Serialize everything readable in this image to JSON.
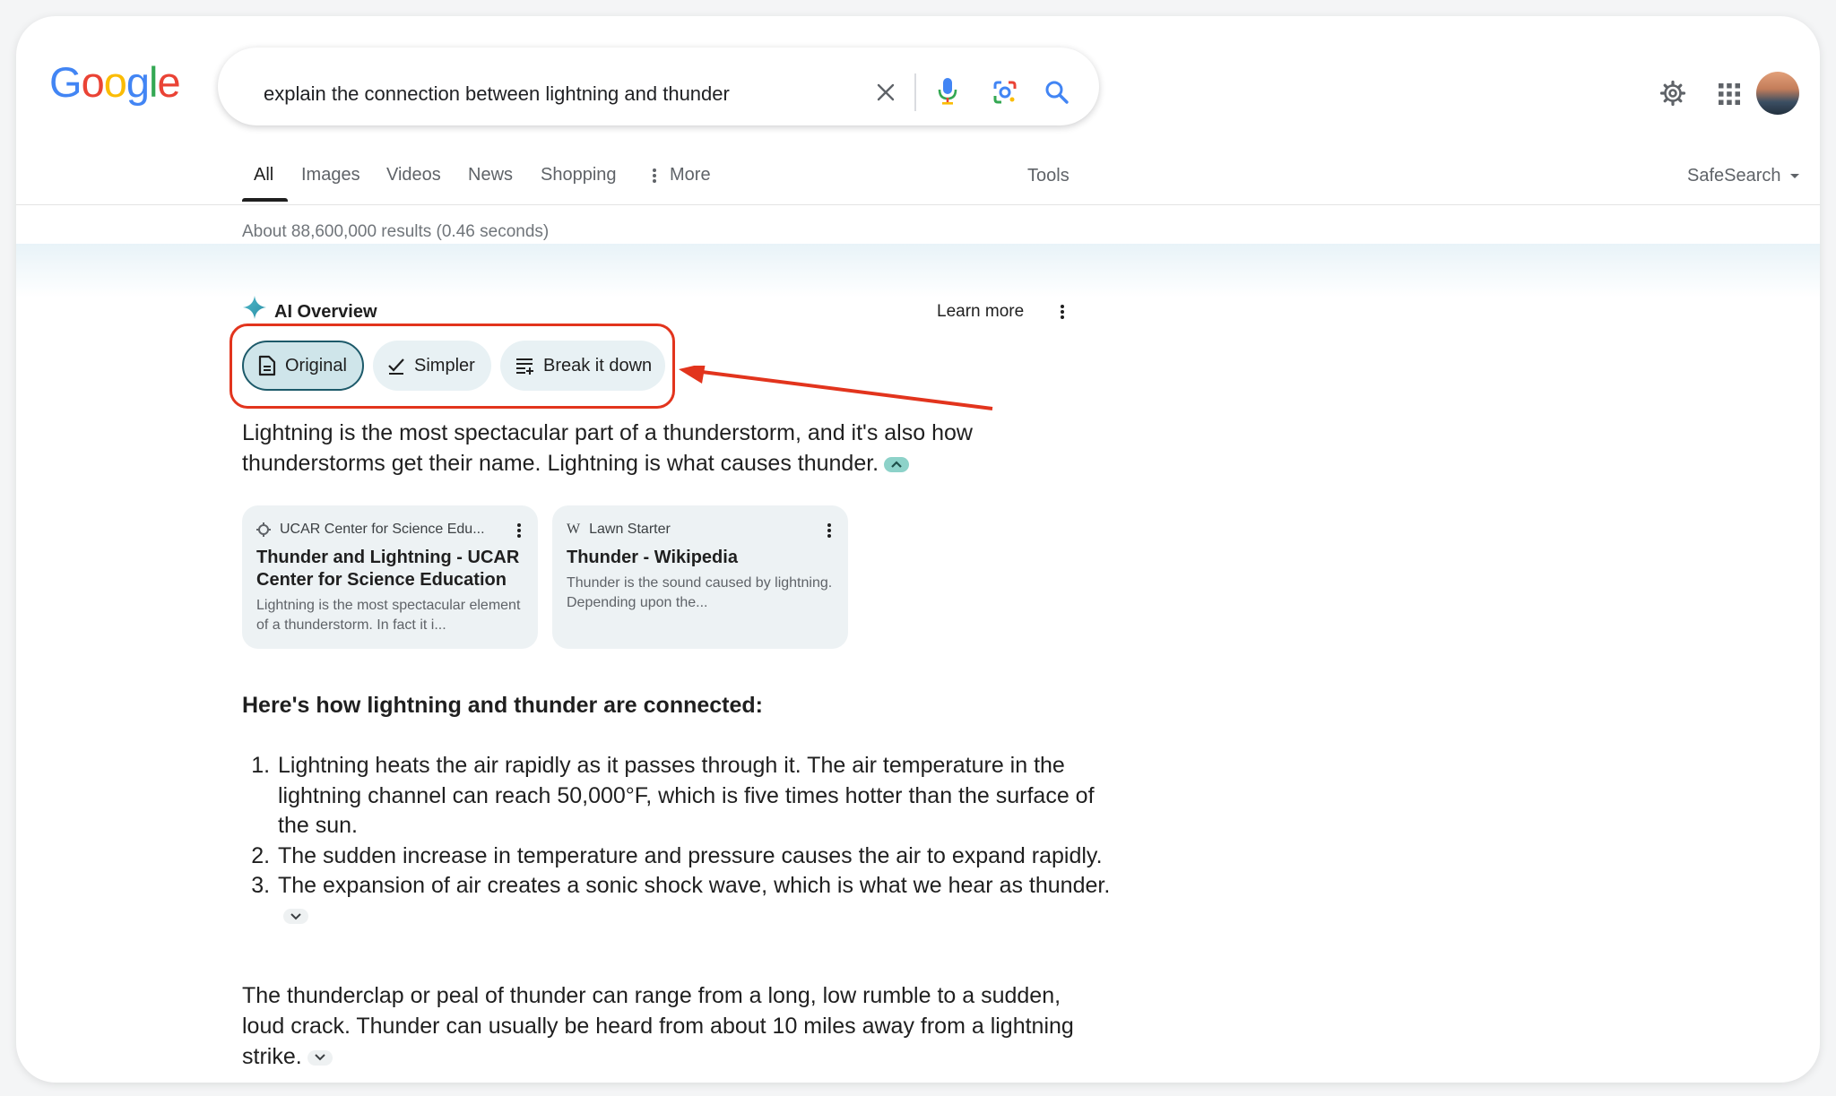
{
  "logo": {
    "letters": [
      "G",
      "o",
      "o",
      "g",
      "l",
      "e"
    ],
    "colors": [
      "#4285F4",
      "#EA4335",
      "#FBBC05",
      "#4285F4",
      "#34A853",
      "#EA4335"
    ]
  },
  "search": {
    "query": "explain the connection between lightning and thunder",
    "icons": [
      "close-icon",
      "mic-icon",
      "lens-icon",
      "search-icon"
    ]
  },
  "header_icons": [
    "settings-icon",
    "apps-icon",
    "avatar"
  ],
  "tabs": [
    "All",
    "Images",
    "Videos",
    "News",
    "Shopping",
    "More"
  ],
  "tools_label": "Tools",
  "safesearch_label": "SafeSearch",
  "stats": "About 88,600,000 results (0.46 seconds)",
  "ai_overview": {
    "title": "AI Overview",
    "learn_more": "Learn more",
    "modes": [
      {
        "label": "Original",
        "icon": "document-icon",
        "selected": true
      },
      {
        "label": "Simpler",
        "icon": "check-icon",
        "selected": false
      },
      {
        "label": "Break it down",
        "icon": "list-icon",
        "selected": false
      }
    ],
    "intro": "Lightning is the most spectacular part of a thunderstorm, and it's also how thunderstorms get their name. Lightning is what causes thunder.",
    "sources": [
      {
        "site": "UCAR Center for Science Edu...",
        "title": "Thunder and Lightning - UCAR Center for Science Education",
        "snippet": "Lightning is the most spectacular element of a thunderstorm. In fact it i..."
      },
      {
        "site": "Lawn Starter",
        "title": "Thunder - Wikipedia",
        "snippet": "Thunder is the sound caused by lightning. Depending upon the..."
      }
    ],
    "heading": "Here's how lightning and thunder are connected:",
    "steps": [
      "Lightning heats the air rapidly as it passes through it. The air temperature in the lightning channel can reach 50,000°F, which is five times hotter than the surface of the sun.",
      "The sudden increase in temperature and pressure causes the air to expand rapidly.",
      "The expansion of air creates a sonic shock wave, which is what we hear as thunder."
    ],
    "closing": "The thunderclap or peal of thunder can range from a long, low rumble to a sudden, loud crack. Thunder can usually be heard from about 10 miles away from a lightning strike."
  },
  "annotation": {
    "color": "#e2341d"
  }
}
